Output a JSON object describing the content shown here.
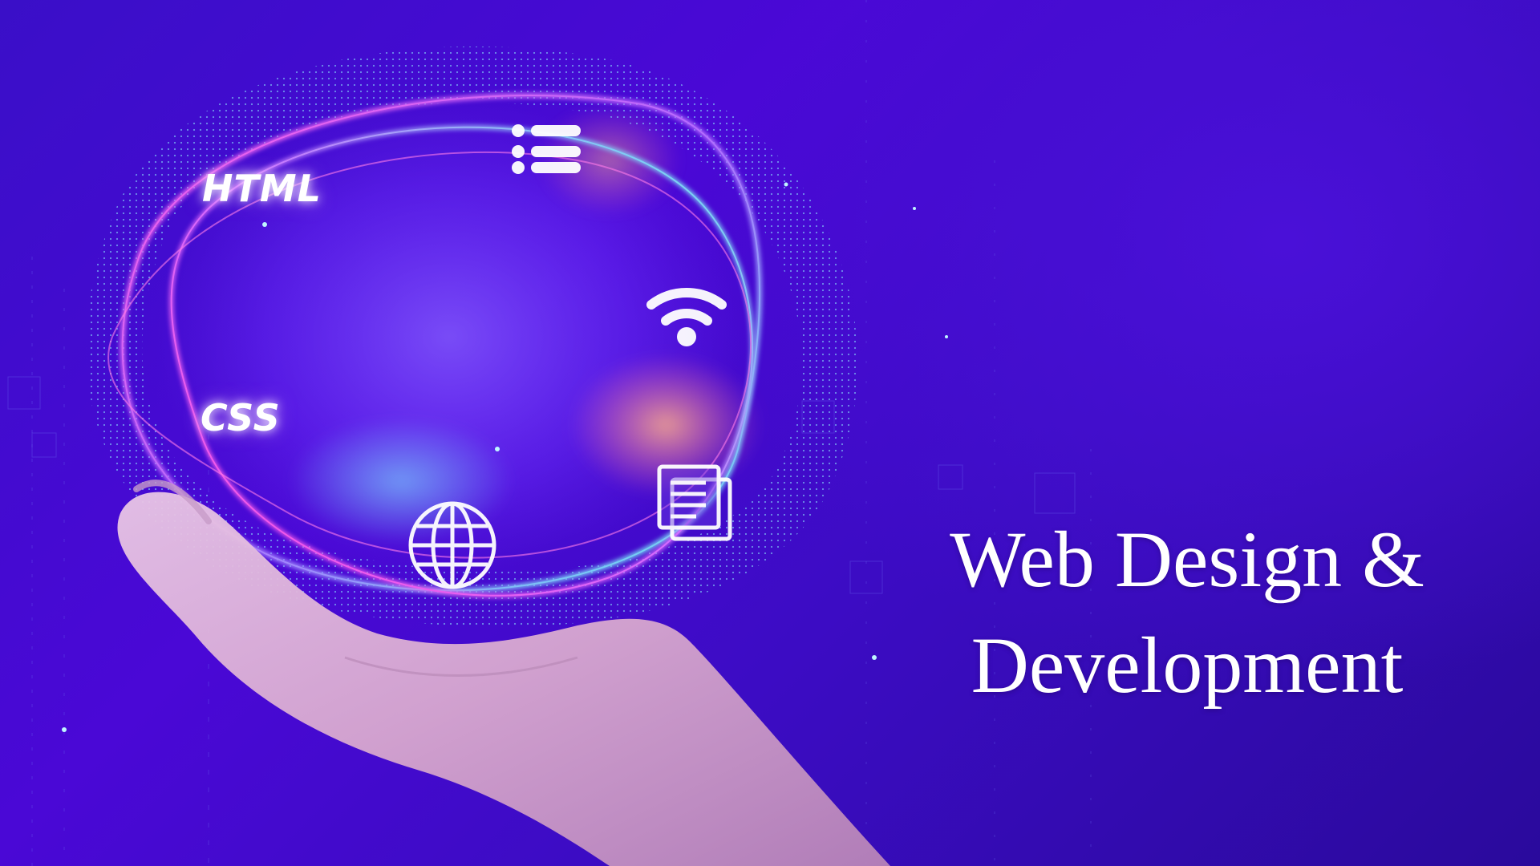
{
  "labels": {
    "html": "HTML",
    "css": "CSS"
  },
  "headline": {
    "line1": "Web Design &",
    "line2": "Development"
  },
  "icons": [
    "menu-list-icon",
    "wifi-icon",
    "document-icon",
    "globe-icon",
    "hand-image"
  ],
  "colors": {
    "background": "#3a0db8",
    "ring_cyan": "#5ff2f0",
    "ring_magenta": "#ff4fe0",
    "text": "#ffffff"
  }
}
